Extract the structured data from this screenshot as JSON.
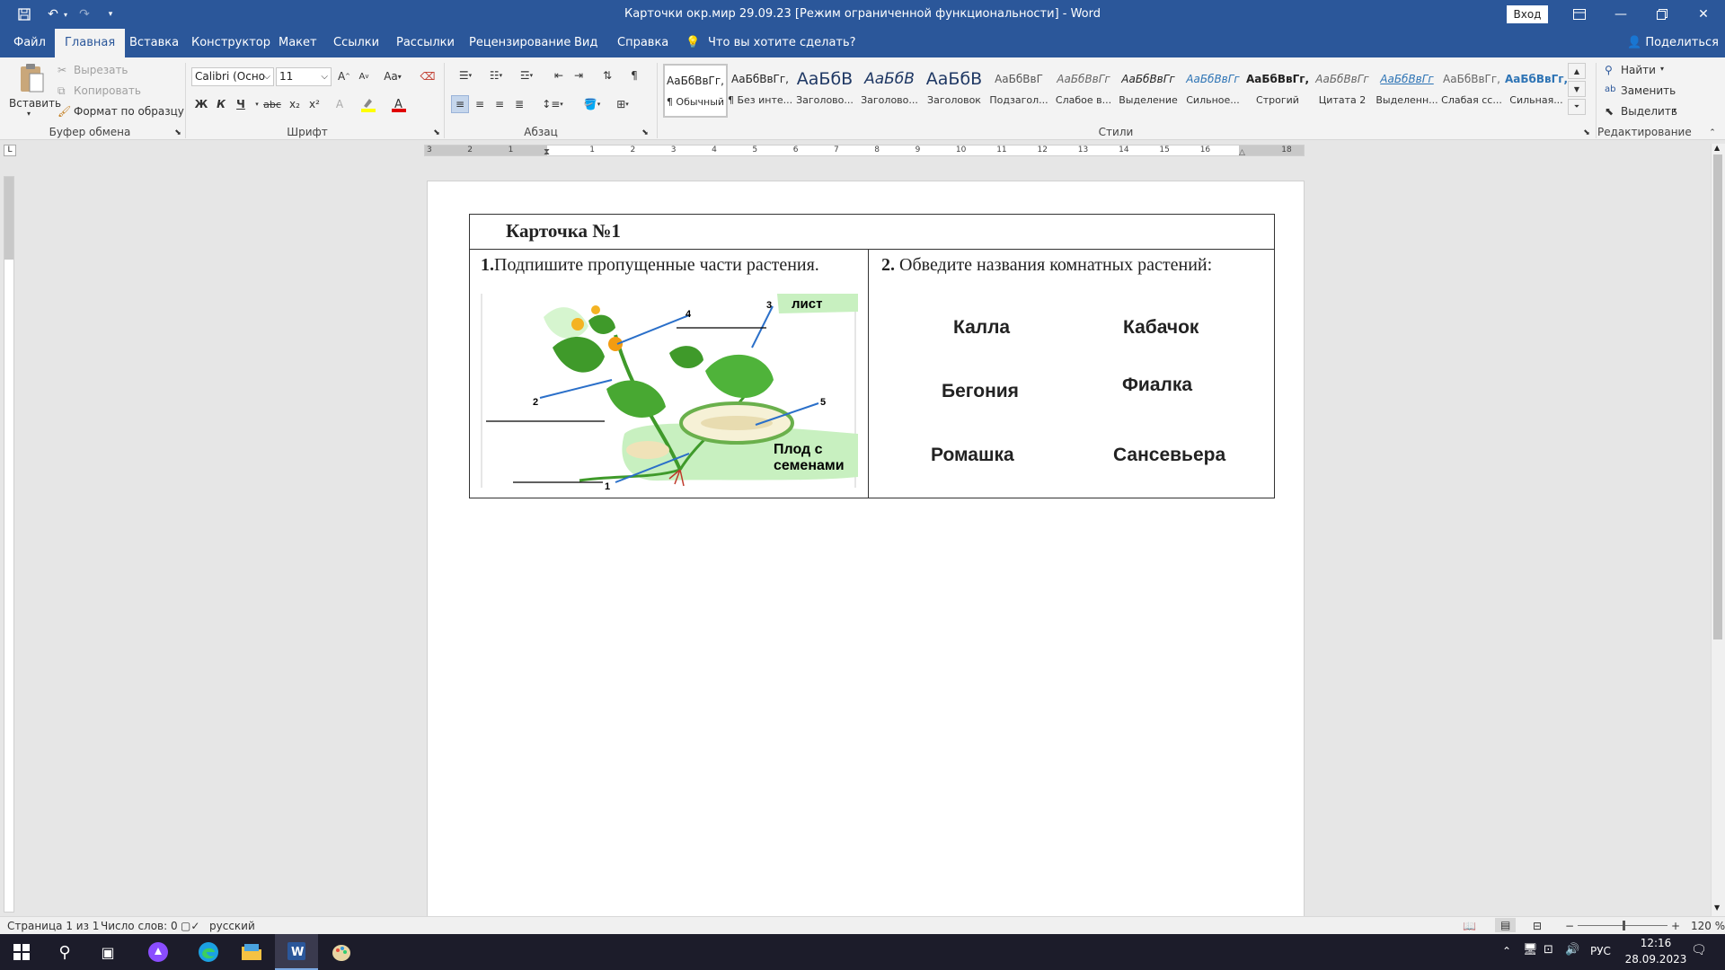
{
  "titlebar": {
    "title": "Карточки окр.мир 29.09.23 [Режим ограниченной функциональности]  -  Word",
    "signin_label": "Вход"
  },
  "tabs": [
    {
      "label": "Файл"
    },
    {
      "label": "Главная",
      "active": true
    },
    {
      "label": "Вставка"
    },
    {
      "label": "Конструктор"
    },
    {
      "label": "Макет"
    },
    {
      "label": "Ссылки"
    },
    {
      "label": "Рассылки"
    },
    {
      "label": "Рецензирование"
    },
    {
      "label": "Вид"
    },
    {
      "label": "Справка"
    }
  ],
  "tell_me": "Что вы хотите сделать?",
  "share_label": "Поделиться",
  "ribbon": {
    "clipboard": {
      "group_label": "Буфер обмена",
      "paste_label": "Вставить",
      "cut_label": "Вырезать",
      "copy_label": "Копировать",
      "format_painter_label": "Формат по образцу"
    },
    "font": {
      "group_label": "Шрифт",
      "font_name": "Calibri (Осно",
      "font_size": "11",
      "bold": "Ж",
      "italic": "К",
      "underline": "Ч",
      "strike": "abc",
      "sub": "x₂",
      "sup": "x²",
      "grow": "A",
      "shrink": "A",
      "case": "Aa"
    },
    "paragraph": {
      "group_label": "Абзац"
    },
    "styles": {
      "group_label": "Стили",
      "items": [
        {
          "preview": "АаБбВвГг,",
          "name": "¶ Обычный"
        },
        {
          "preview": "АаБбВвГг,",
          "name": "¶ Без инте..."
        },
        {
          "preview": "АаБбВ",
          "name": "Заголово..."
        },
        {
          "preview": "АаБбВ",
          "name": "Заголово..."
        },
        {
          "preview": "АаБбВ",
          "name": "Заголовок"
        },
        {
          "preview": "АаБбВвГ",
          "name": "Подзагол..."
        },
        {
          "preview": "АаБбВвГг",
          "name": "Слабое в..."
        },
        {
          "preview": "АаБбВвГг",
          "name": "Выделение"
        },
        {
          "preview": "АаБбВвГг",
          "name": "Сильное..."
        },
        {
          "preview": "АаБбВвГг,",
          "name": "Строгий"
        },
        {
          "preview": "АаБбВвГг",
          "name": "Цитата 2"
        },
        {
          "preview": "АаБбВвГг",
          "name": "Выделенн..."
        },
        {
          "preview": "АаБбВвГг,",
          "name": "Слабая сс..."
        },
        {
          "preview": "АаБбВвГг,",
          "name": "Сильная..."
        }
      ]
    },
    "editing": {
      "group_label": "Редактирование",
      "find_label": "Найти",
      "replace_label": "Заменить",
      "select_label": "Выделить"
    }
  },
  "ruler_labels": [
    "3",
    "2",
    "1",
    "",
    "1",
    "2",
    "3",
    "4",
    "5",
    "6",
    "7",
    "8",
    "9",
    "10",
    "11",
    "12",
    "13",
    "14",
    "15",
    "16",
    "",
    "18"
  ],
  "document": {
    "card_title": "Карточка №1",
    "q1_num": "1.",
    "q1_text": "Подпишите пропущенные части растения.",
    "q2_num": "2.",
    "q2_text": " Обведите названия комнатных растений:",
    "diagram": {
      "label_leaf": "лист",
      "label_fruit_1": "Плод с",
      "label_fruit_2": "семенами",
      "n1": "1",
      "n2": "2",
      "n3": "3",
      "n4": "4",
      "n5": "5"
    },
    "plants": [
      {
        "name": "Калла"
      },
      {
        "name": "Кабачок"
      },
      {
        "name": "Бегония"
      },
      {
        "name": "Фиалка"
      },
      {
        "name": "Ромашка"
      },
      {
        "name": "Сансевьера"
      }
    ]
  },
  "status": {
    "page": "Страница 1 из 1",
    "words": "Число слов: 0",
    "language": "русский",
    "zoom": "120 %"
  },
  "taskbar": {
    "language": "РУС",
    "time": "12:16",
    "date": "28.09.2023"
  },
  "colors": {
    "word_blue": "#2b579a",
    "plant_green": "#3f9a2a",
    "highlight_green": "#c8f0c0",
    "pointer_blue": "#2a6fc9"
  }
}
